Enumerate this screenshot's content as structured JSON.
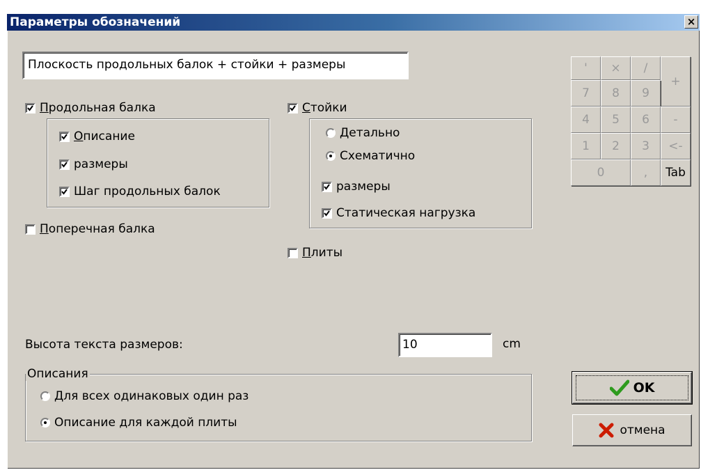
{
  "window": {
    "title": "Параметры обозначений",
    "close_label": "×"
  },
  "plane_name": "Плоскость продольных балок + стойки + размеры",
  "longitudinal": {
    "label_u": "П",
    "label_rest": "родольная балка",
    "checked": true,
    "options": [
      {
        "label_u": "О",
        "label_rest": "писание",
        "checked": true
      },
      {
        "label_u": "",
        "label_rest": "размеры",
        "checked": true
      },
      {
        "label_u": "",
        "label_rest": "Шаг продольных балок",
        "checked": true
      }
    ]
  },
  "transverse": {
    "label_u": "П",
    "label_rest": "оперечная балка",
    "checked": false
  },
  "posts": {
    "label_u": "С",
    "label_rest": "тойки",
    "checked": true,
    "radios": [
      {
        "label": "Детально",
        "selected": false
      },
      {
        "label": "Схематично",
        "selected": true
      }
    ],
    "options": [
      {
        "label": "размеры",
        "checked": true
      },
      {
        "label": "Статическая нагрузка",
        "checked": true
      }
    ]
  },
  "slabs": {
    "label_u": "П",
    "label_rest": "литы",
    "checked": false
  },
  "dimension_text_height": {
    "label": "Высота текста размеров:",
    "value": "10",
    "unit": "cm"
  },
  "descriptions": {
    "title": "Описания",
    "options": [
      {
        "label": "Для всех одинаковых один раз",
        "selected": false
      },
      {
        "label": "Описание для каждой плиты",
        "selected": true
      }
    ]
  },
  "keypad": {
    "row1": [
      "'",
      "×",
      "/"
    ],
    "row2": [
      "7",
      "8",
      "9"
    ],
    "row3": [
      "4",
      "5",
      "6"
    ],
    "row4": [
      "1",
      "2",
      "3"
    ],
    "zero": "0",
    "comma": ",",
    "tab": "Tab",
    "plus": "+",
    "minus": "-",
    "backspace": "<-"
  },
  "buttons": {
    "ok_label": "OK",
    "cancel_label": "отмена"
  },
  "colors": {
    "title_start": "#0a246a",
    "title_end": "#a6caf0",
    "face": "#d4d0c8",
    "ok_check": "#2e9b1e",
    "cancel_x": "#cc1c00"
  }
}
